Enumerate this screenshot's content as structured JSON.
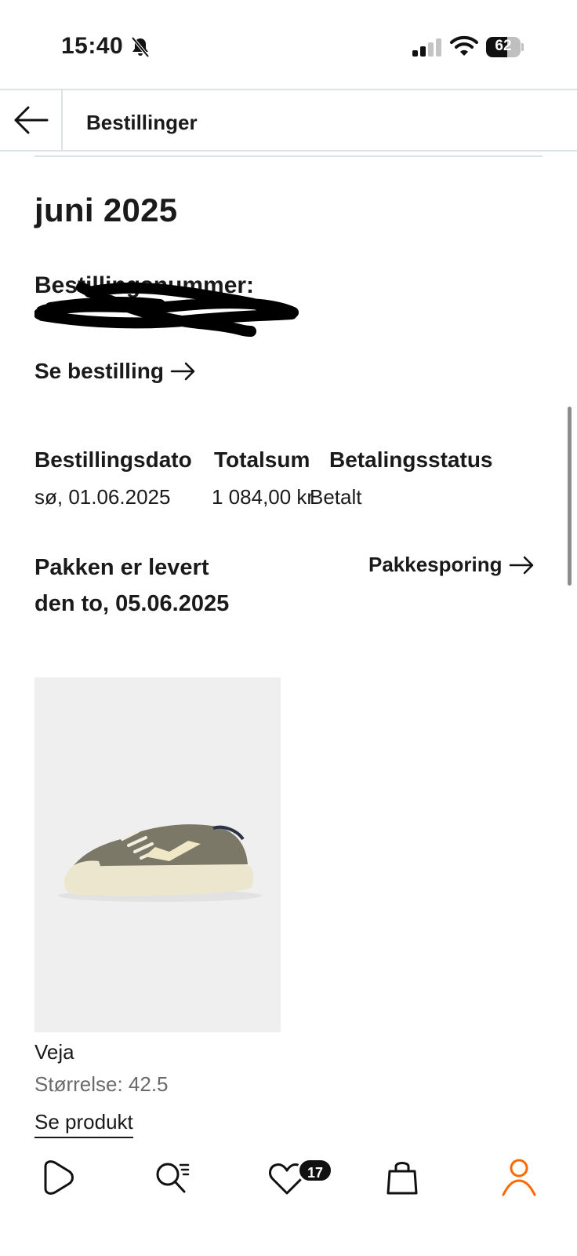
{
  "status_bar": {
    "time": "15:40",
    "battery": "62",
    "battery_level": 0.62,
    "icons": [
      "bell-slash-icon",
      "cellular-signal-icon",
      "wifi-icon",
      "battery-icon"
    ]
  },
  "header": {
    "title": "Bestillinger",
    "back_icon": "arrow-left-icon"
  },
  "order": {
    "month": "juni 2025",
    "number_label": "Bestillingsnummer:",
    "see_order": "Se bestilling",
    "info": {
      "date_label": "Bestillingsdato",
      "total_label": "Totalsum",
      "payment_label": "Betalingsstatus",
      "date_value": "sø, 01.06.2025",
      "total_value": "1 084,00 kr",
      "payment_value": "Betalt"
    },
    "delivery_status": "Pakken er levert den to, 05.06.2025",
    "tracking_label": "Pakkesporing"
  },
  "product": {
    "brand": "Veja",
    "size": "Størrelse: 42.5",
    "see_product": "Se produkt"
  },
  "bottom_nav": {
    "items": [
      "home-icon",
      "search-icon",
      "heart-icon",
      "bag-icon",
      "profile-icon"
    ],
    "wishlist_count": "17",
    "active_color": "#ff6900"
  }
}
